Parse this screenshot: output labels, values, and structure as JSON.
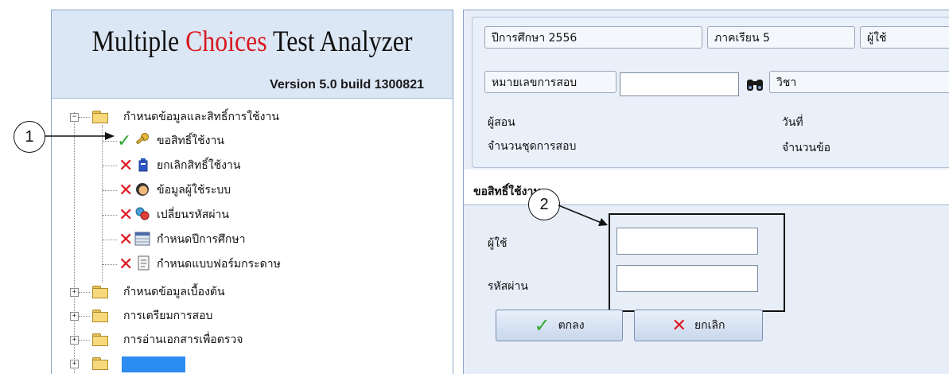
{
  "left_panel": {
    "title_part1": "Multiple ",
    "title_part2": "Choices",
    "title_part3": " Test Analyzer",
    "version": "Version 5.0  build 1300821",
    "tree": [
      {
        "label": "กำหนดข้อมูลและสิทธิ์การใช้งาน",
        "expanded": true,
        "children": [
          {
            "label": "ขอสิทธิ์ใช้งาน",
            "status": "check",
            "icon": "key-icon"
          },
          {
            "label": "ยกเลิกสิทธิ์ใช้งาน",
            "status": "x",
            "icon": "battery-icon"
          },
          {
            "label": "ข้อมูลผู้ใช้ระบบ",
            "status": "x",
            "icon": "user-head-icon"
          },
          {
            "label": "เปลี่ยนรหัสผ่าน",
            "status": "x",
            "icon": "keys-icon"
          },
          {
            "label": "กำหนดปีการศึกษา",
            "status": "x",
            "icon": "calendar-icon"
          },
          {
            "label": "กำหนดแบบฟอร์มกระดาษ",
            "status": "x",
            "icon": "form-icon"
          }
        ]
      },
      {
        "label": "กำหนดข้อมูลเบื้องต้น",
        "expanded": false
      },
      {
        "label": "การเตรียมการสอบ",
        "expanded": false
      },
      {
        "label": "การอ่านเอกสารเพื่อตรวจ",
        "expanded": false
      }
    ]
  },
  "info": {
    "year_label": "ปีการศึกษา  2556",
    "semester_label": "ภาคเรียน  5",
    "user_label": "ผู้ใช้",
    "exam_no_label": "หมายเลขการสอบ",
    "exam_no_value": "",
    "subject_label": "วิชา",
    "teacher_label": "ผู้สอน",
    "date_label": "วันที่",
    "sets_label": "จำนวนชุดการสอบ",
    "items_label": "จำนวนข้อ"
  },
  "form": {
    "title": "ขอสิทธิ์ใช้งาน",
    "user_label": "ผู้ใช้",
    "user_value": "",
    "password_label": "รหัสผ่าน",
    "password_value": "",
    "ok_label": "ตกลง",
    "cancel_label": "ยกเลิก"
  },
  "annotations": {
    "callout1": "1",
    "callout2": "2"
  },
  "colors": {
    "accent_red": "#d9181f",
    "check_green": "#2fa82f",
    "panel_bg": "#e7eef8"
  }
}
